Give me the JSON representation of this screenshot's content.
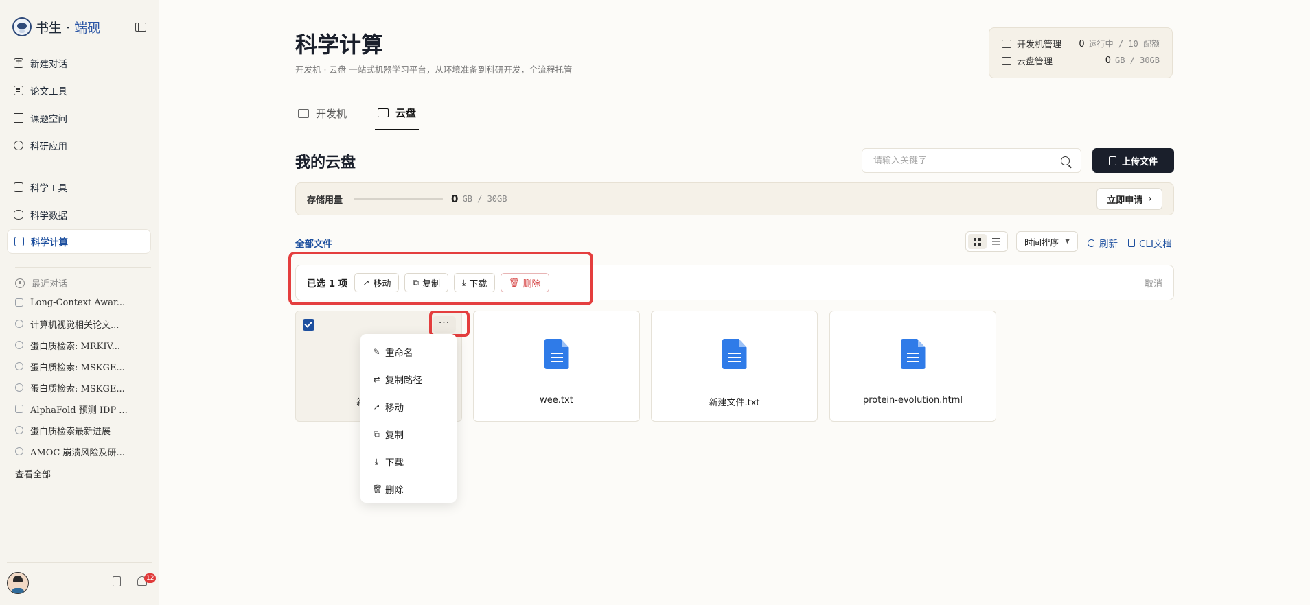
{
  "app": {
    "logo_main": "书生",
    "logo_sep": " · ",
    "logo_accent": "端砚"
  },
  "sidebar": {
    "primary": [
      {
        "label": "新建对话",
        "icon": "plus-square-icon"
      },
      {
        "label": "论文工具",
        "icon": "document-icon"
      },
      {
        "label": "课题空间",
        "icon": "books-icon"
      },
      {
        "label": "科研应用",
        "icon": "hexagon-icon"
      }
    ],
    "secondary": [
      {
        "label": "科学工具",
        "icon": "toolbox-icon"
      },
      {
        "label": "科学数据",
        "icon": "database-icon"
      },
      {
        "label": "科学计算",
        "icon": "monitor-icon",
        "active": true
      }
    ],
    "recent_title": "最近对话",
    "recent": [
      {
        "label": "Long-Context Awar..."
      },
      {
        "label": "计算机视觉相关论文..."
      },
      {
        "label": "蛋白质检索: MRKIV..."
      },
      {
        "label": "蛋白质检索: MSKGE..."
      },
      {
        "label": "蛋白质检索: MSKGE..."
      },
      {
        "label": "AlphaFold 预测 IDP ..."
      },
      {
        "label": "蛋白质检索最新进展"
      },
      {
        "label": "AMOC 崩溃风险及研..."
      }
    ],
    "view_all": "查看全部",
    "notification_count": "12"
  },
  "header": {
    "title": "科学计算",
    "subtitle": "开发机 · 云盘 一站式机器学习平台，从环境准备到科研开发，全流程托管"
  },
  "quota": {
    "dev_label": "开发机管理",
    "dev_value": "0",
    "dev_unit": "运行中 / 10 配额",
    "disk_label": "云盘管理",
    "disk_value": "0",
    "disk_unit": "GB / 30GB"
  },
  "tabs": [
    {
      "label": "开发机",
      "active": false
    },
    {
      "label": "云盘",
      "active": true
    }
  ],
  "cloud": {
    "title": "我的云盘",
    "search_placeholder": "请输入关键字",
    "upload_label": "上传文件",
    "storage_label": "存储用量",
    "storage_used": "0",
    "storage_unit": "GB / 30GB",
    "storage_fraction": 0,
    "apply_label": "立即申请",
    "all_files": "全部文件",
    "sort_label": "时间排序",
    "refresh_label": "刷新",
    "cli_label": "CLI文档"
  },
  "selection": {
    "count_label": "已选 1 项",
    "move": "移动",
    "copy": "复制",
    "download": "下载",
    "delete": "删除",
    "cancel": "取消"
  },
  "files": [
    {
      "name": "新",
      "selected": true
    },
    {
      "name": "wee.txt",
      "selected": false
    },
    {
      "name": "新建文件.txt",
      "selected": false
    },
    {
      "name": "protein-evolution.html",
      "selected": false
    }
  ],
  "context_menu": [
    {
      "label": "重命名",
      "icon": "edit-icon"
    },
    {
      "label": "复制路径",
      "icon": "link-icon"
    },
    {
      "label": "移动",
      "icon": "arrow-up-right-icon"
    },
    {
      "label": "复制",
      "icon": "copy-icon"
    },
    {
      "label": "下载",
      "icon": "download-icon"
    },
    {
      "label": "删除",
      "icon": "trash-icon"
    }
  ],
  "colors": {
    "accent": "#1d4f9e",
    "danger": "#d64545",
    "highlight": "#e43e3e",
    "file_icon": "#2f7be8"
  }
}
